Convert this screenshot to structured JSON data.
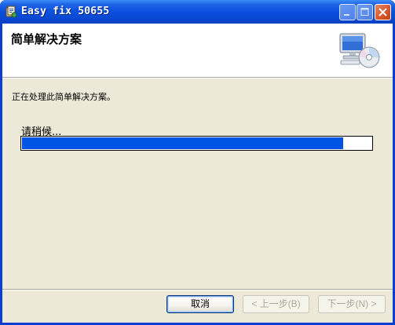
{
  "window": {
    "title": "Easy fix 50655"
  },
  "header": {
    "title": "简单解决方案"
  },
  "main": {
    "status_text": "正在处理此简单解决方案。",
    "wait_text": "请稍候...",
    "progress_fraction": 0.92
  },
  "buttons": {
    "cancel": "取消",
    "back": "< 上一步(B)",
    "next": "下一步(N) >"
  },
  "colors": {
    "titlebar": "#0a48d2",
    "progress": "#0054e3",
    "client_bg": "#ece9d8"
  },
  "icons": {
    "app": "installer-icon",
    "header_art": "computer-cd-icon",
    "minimize": "minimize-icon",
    "maximize": "maximize-icon",
    "close": "close-icon"
  }
}
